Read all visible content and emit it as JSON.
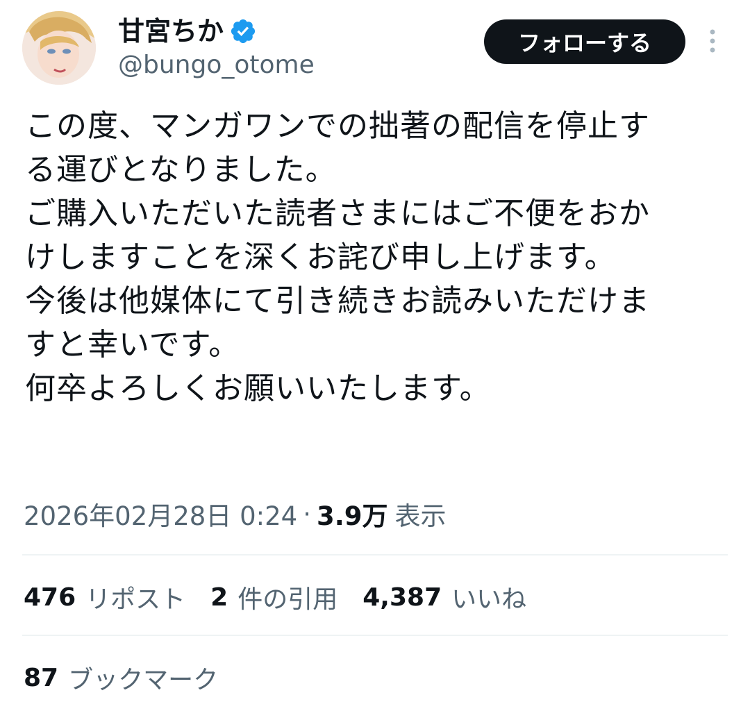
{
  "author": {
    "display_name": "甘宮ちか",
    "handle": "@bungo_otome",
    "verified_icon": "verified-badge-icon",
    "verified_color": "#1d9bf0"
  },
  "header": {
    "follow_label": "フォローする",
    "more_icon": "more-vertical-icon"
  },
  "tweet": {
    "lines": [
      "この度、マンガワンでの拙著の配信を停止す",
      "る運びとなりました。",
      "ご購入いただいた読者さまにはご不便をおか",
      "けしますことを深くお詫び申し上げます。",
      "今後は他媒体にて引き続きお読みいただけま",
      "すと幸いです。",
      "何卒よろしくお願いいたします。"
    ]
  },
  "meta": {
    "timestamp": "2026年02月28日 0:24",
    "separator": "·",
    "views_count": "3.9万",
    "views_label": "表示"
  },
  "stats": {
    "reposts": {
      "count": "476",
      "label": "リポスト"
    },
    "quotes": {
      "count": "2",
      "label": "件の引用"
    },
    "likes": {
      "count": "4,387",
      "label": "いいね"
    }
  },
  "bookmarks": {
    "count": "87",
    "label": "ブックマーク"
  },
  "colors": {
    "text_primary": "#0f1419",
    "text_secondary": "#536471",
    "divider": "#eff3f4",
    "button_bg": "#0f1419"
  }
}
